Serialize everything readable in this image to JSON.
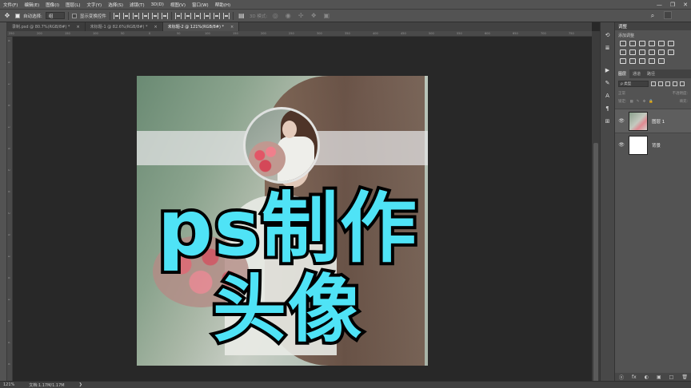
{
  "menubar": {
    "items": [
      "文件(F)",
      "编辑(E)",
      "图像(I)",
      "图层(L)",
      "文字(Y)",
      "选择(S)",
      "滤镜(T)",
      "3D(D)",
      "视图(V)",
      "窗口(W)",
      "帮助(H)"
    ],
    "window_controls": [
      "—",
      "❐",
      "✕"
    ]
  },
  "options": {
    "auto_select_label": "自动选择:",
    "auto_select_value": "组",
    "transform_label": "显示变换控件",
    "mode_3d_label": "3D 模式:"
  },
  "tabs": [
    {
      "label": "录制.psd @ 80.7%(RGB/8#) *",
      "close": "×"
    },
    {
      "label": "未标题-1 @ 82.6%(RGB/8#) *",
      "close": "×"
    },
    {
      "label": "未标题-2 @ 121%(RGB/8#) *",
      "close": "×"
    }
  ],
  "ruler": {
    "top": [
      "250",
      "200",
      "150",
      "100",
      "50",
      "0",
      "50",
      "100",
      "150",
      "200",
      "250",
      "300",
      "350",
      "400",
      "450",
      "500",
      "550",
      "600",
      "650",
      "700",
      "750"
    ],
    "left": [
      "0",
      "5",
      "1",
      "0",
      "1",
      "5",
      "2",
      "0",
      "2",
      "5",
      "3",
      "0",
      "3",
      "5",
      "4",
      "0"
    ]
  },
  "canvas": {
    "line1": "ps制作",
    "line2": "头像"
  },
  "statusbar": {
    "zoom": "121%",
    "doc": "文档:1.17M/1.17M",
    "arrow": "❯"
  },
  "right_panel": {
    "adjust_title": "调整",
    "add_adjust": "添加调整",
    "layers_tabs": [
      "图层",
      "通道",
      "路径"
    ],
    "filter_kind": "ρ 类型",
    "blend_mode": "正常",
    "opacity_label": "不透明度:",
    "lock_label": "锁定:",
    "fill_label": "填充:",
    "layers": [
      {
        "name": "图层 1",
        "eye": "👁"
      },
      {
        "name": "背景",
        "eye": "👁"
      }
    ],
    "footer_icons": [
      "ⓞ",
      "fx",
      "◐",
      "▣",
      "□",
      "🗑"
    ]
  }
}
